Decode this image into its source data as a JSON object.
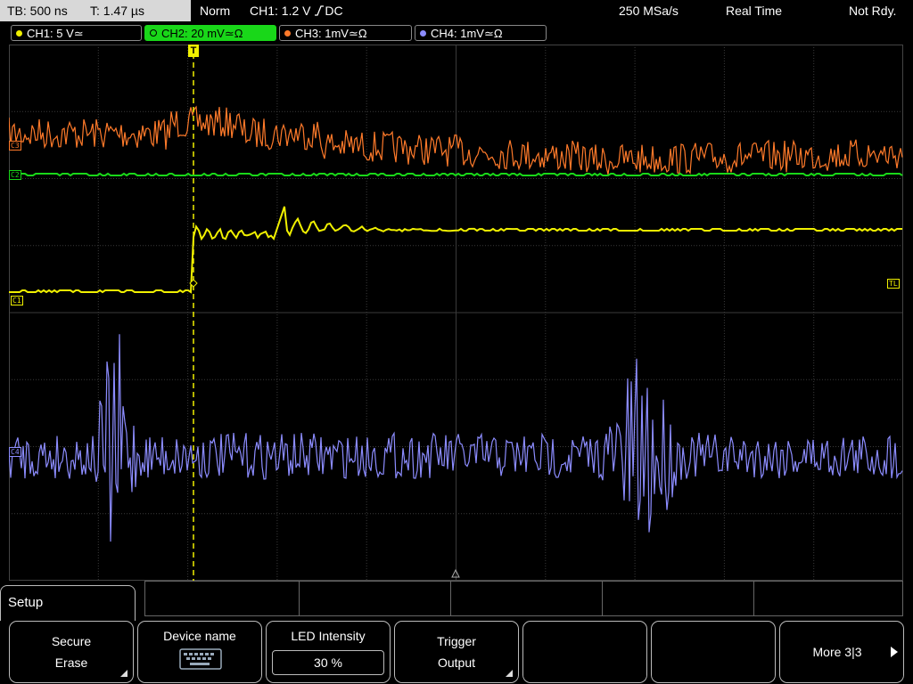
{
  "top_bar": {
    "timebase": "TB: 500 ns",
    "trigger_time": "T: 1.47 µs",
    "trigger_mode": "Norm",
    "trigger_info": "CH1: 1.2 V",
    "trigger_coupling": "DC",
    "sample_rate": "250 MSa/s",
    "acq_mode": "Real Time",
    "status": "Not Rdy."
  },
  "channels": [
    {
      "label": "CH1: 5 V",
      "suffix": "≃",
      "color": "#f0f000",
      "active": false
    },
    {
      "label": "CH2: 20 mV",
      "suffix": "≃Ω",
      "color": "#19d719",
      "active": true
    },
    {
      "label": "CH3: 1mV",
      "suffix": "≃Ω",
      "color": "#ff7a2a",
      "active": false
    },
    {
      "label": "CH4: 1mV",
      "suffix": "≃Ω",
      "color": "#8c8cff",
      "active": false
    }
  ],
  "markers": {
    "ch3": "C3",
    "ch2": "C2",
    "ch1": "C1",
    "ch4": "C4",
    "trigger_level": "TL",
    "trigger_pos": "T"
  },
  "setup_menu": {
    "title": "Setup",
    "softkeys": [
      {
        "line1": "Secure",
        "line2": "Erase",
        "has_submenu": true
      },
      {
        "line1": "Device name",
        "icon": "keyboard-icon"
      },
      {
        "line1": "LED Intensity",
        "value": "30 %"
      },
      {
        "line1": "Trigger",
        "line2": "Output",
        "has_submenu": true
      },
      {
        "line1": ""
      },
      {
        "line1": ""
      },
      {
        "line1": "More 3|3",
        "icon": "arrow-right-icon"
      }
    ]
  }
}
